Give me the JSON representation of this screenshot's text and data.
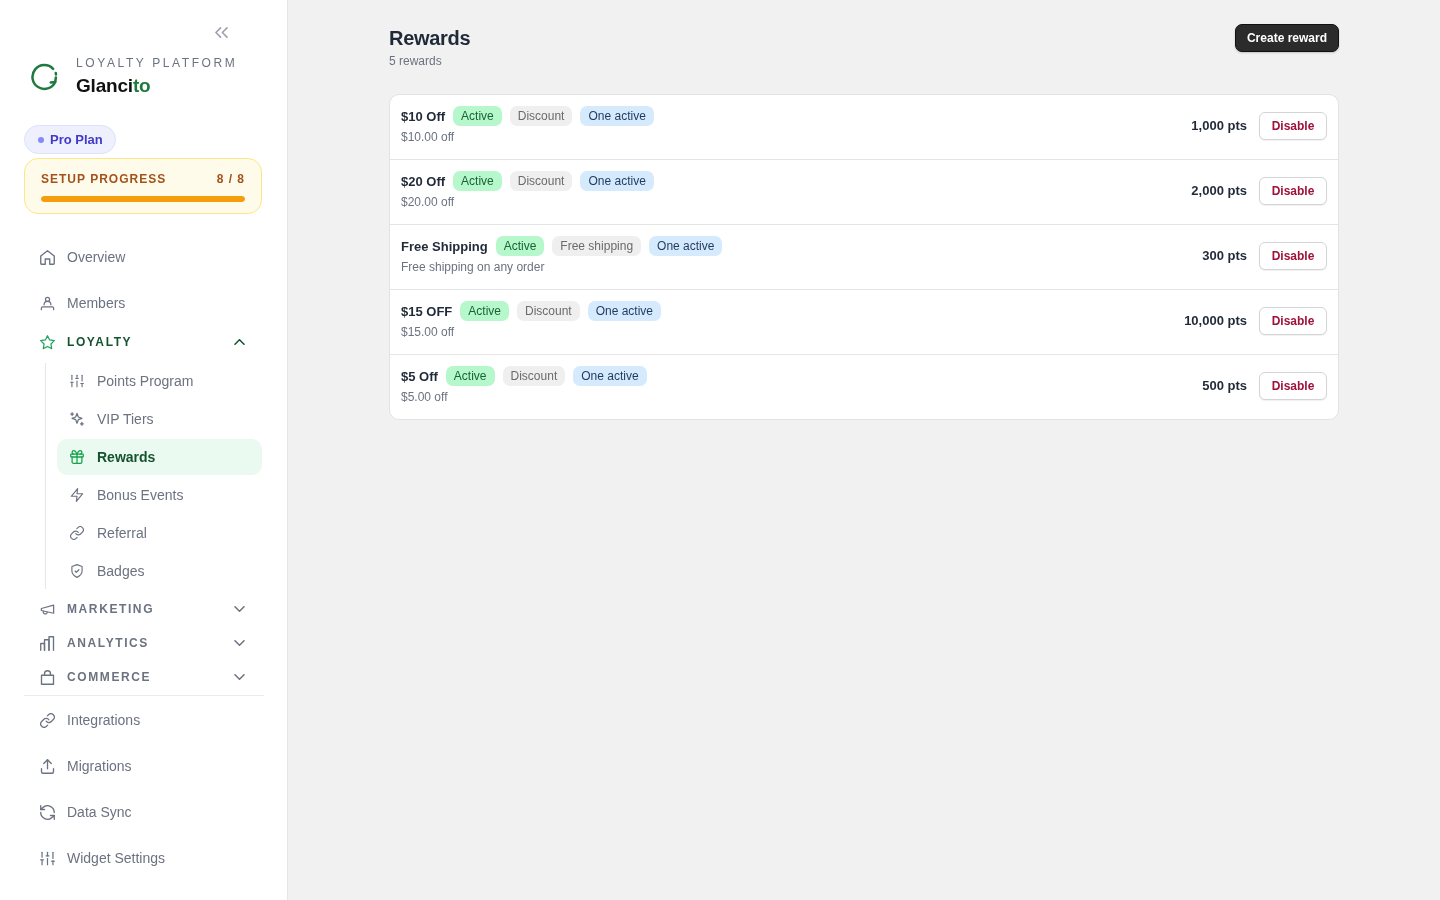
{
  "sidebar": {
    "brand": {
      "tagline": "LOYALTY PLATFORM",
      "name": "Glanci",
      "name_accent": "to"
    },
    "plan_badge": {
      "label": "Pro Plan"
    },
    "setup_progress": {
      "label": "SETUP PROGRESS",
      "count": "8 / 8",
      "level": 1
    },
    "nav": {
      "top_items": [
        {
          "label": "Overview",
          "selected": false
        },
        {
          "label": "Members",
          "selected": false
        }
      ],
      "groups": [
        {
          "label": "LOYALTY",
          "selected": true,
          "expanded": true,
          "children": [
            {
              "label": "Points Program",
              "selected": false
            },
            {
              "label": "VIP Tiers",
              "selected": false
            },
            {
              "label": "Rewards",
              "selected": true
            },
            {
              "label": "Bonus Events",
              "selected": false
            },
            {
              "label": "Referral",
              "selected": false
            },
            {
              "label": "Badges",
              "selected": false
            }
          ]
        },
        {
          "label": "MARKETING",
          "selected": false,
          "expanded": false
        },
        {
          "label": "ANALYTICS",
          "selected": false,
          "expanded": false
        },
        {
          "label": "COMMERCE",
          "selected": false,
          "expanded": false
        }
      ],
      "bottom_items": [
        {
          "label": "Integrations",
          "selected": false
        },
        {
          "label": "Migrations",
          "selected": false
        },
        {
          "label": "Data Sync",
          "selected": false
        },
        {
          "label": "Widget Settings",
          "selected": false
        }
      ]
    }
  },
  "page": {
    "title": "Rewards",
    "subtitle": "5 rewards",
    "create_button": "Create reward"
  },
  "rewards": [
    {
      "name": "$10 Off",
      "tags": [
        {
          "label": "Active",
          "kind": "status"
        },
        {
          "label": "Discount",
          "kind": "type"
        },
        {
          "label": "One active",
          "kind": "limit"
        }
      ],
      "description": "$10.00 off",
      "points": "1,000 pts",
      "action": "Disable"
    },
    {
      "name": "$20 Off",
      "tags": [
        {
          "label": "Active",
          "kind": "status"
        },
        {
          "label": "Discount",
          "kind": "type"
        },
        {
          "label": "One active",
          "kind": "limit"
        }
      ],
      "description": "$20.00 off",
      "points": "2,000 pts",
      "action": "Disable"
    },
    {
      "name": "Free Shipping",
      "tags": [
        {
          "label": "Active",
          "kind": "status"
        },
        {
          "label": "Free shipping",
          "kind": "type"
        },
        {
          "label": "One active",
          "kind": "limit"
        }
      ],
      "description": "Free shipping on any order",
      "points": "300 pts",
      "action": "Disable"
    },
    {
      "name": "$15 OFF",
      "tags": [
        {
          "label": "Active",
          "kind": "status"
        },
        {
          "label": "Discount",
          "kind": "type"
        },
        {
          "label": "One active",
          "kind": "limit"
        }
      ],
      "description": "$15.00 off",
      "points": "10,000 pts",
      "action": "Disable"
    },
    {
      "name": "$5 Off",
      "tags": [
        {
          "label": "Active",
          "kind": "status"
        },
        {
          "label": "Discount",
          "kind": "type"
        },
        {
          "label": "One active",
          "kind": "limit"
        }
      ],
      "description": "$5.00 off",
      "points": "500 pts",
      "action": "Disable"
    }
  ]
}
